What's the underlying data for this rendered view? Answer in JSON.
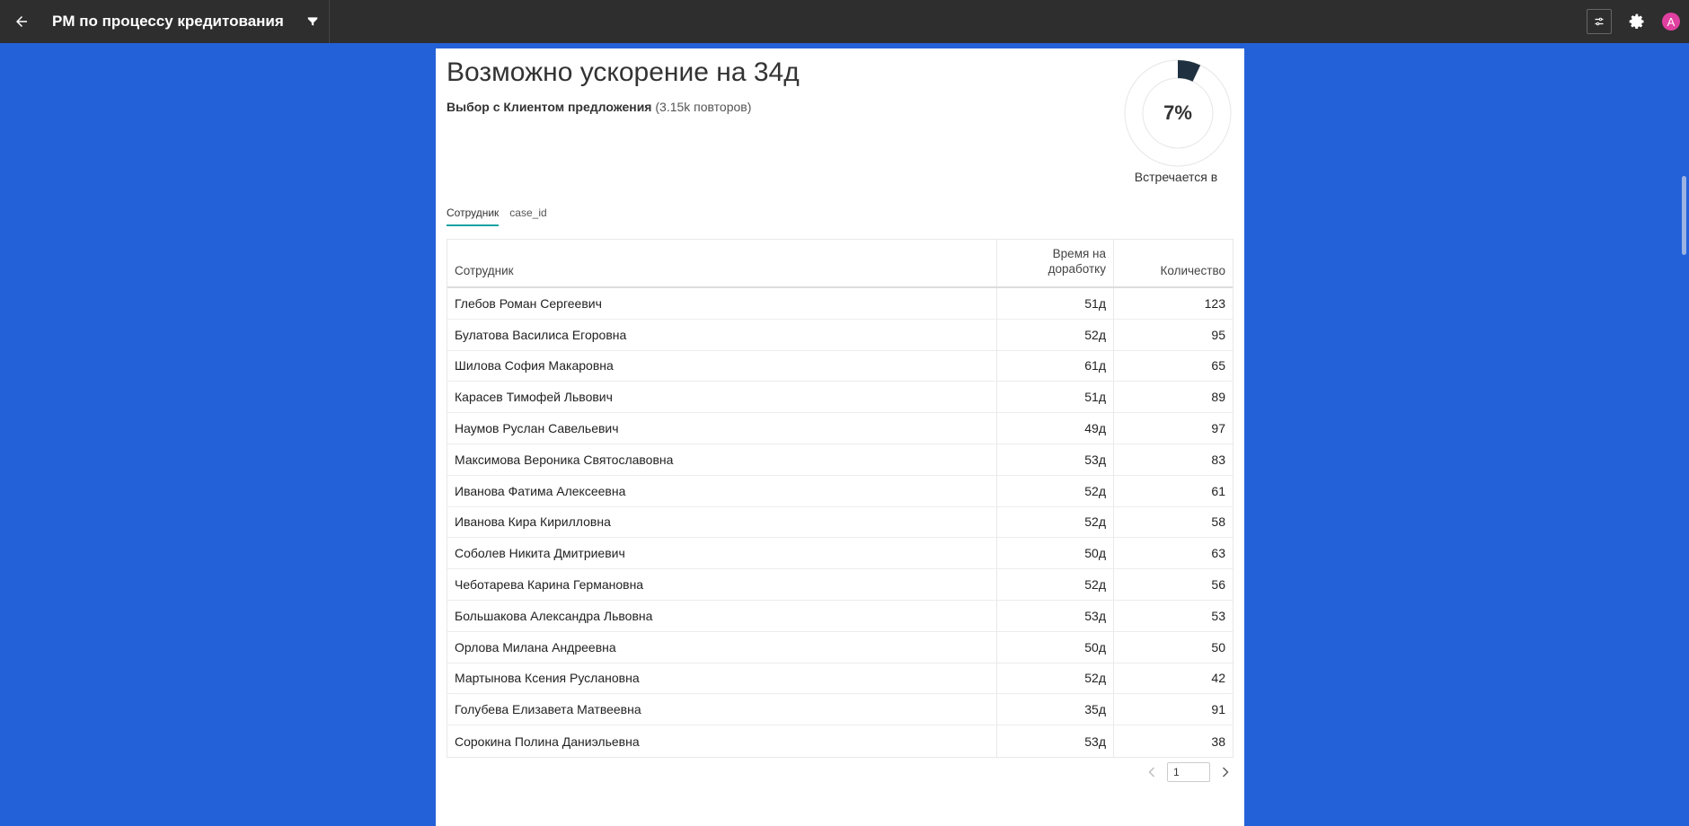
{
  "header": {
    "title": "PM по процессу кредитования",
    "avatar_letter": "A"
  },
  "icons": {
    "back": "arrow-left-icon",
    "filter": "filter-icon",
    "sliders": "sliders-icon",
    "settings": "gear-icon"
  },
  "colors": {
    "background": "#2361d8",
    "topbar": "#2e2e2e",
    "avatar": "#e040a0",
    "tab_accent": "#1aa3a3",
    "donut_fill": "#1f3040"
  },
  "summary": {
    "headline": "Возможно ускорение на 34д",
    "activity": "Выбор с Клиентом предложения",
    "repeats": "(3.15k повторов)",
    "donut_percent_label": "7%",
    "donut_fraction": 0.07,
    "donut_caption": "Встречается в"
  },
  "tabs": [
    {
      "label": "Сотрудник",
      "active": true
    },
    {
      "label": "case_id",
      "active": false
    }
  ],
  "table": {
    "columns": {
      "name": "Сотрудник",
      "time": "Время на доработку",
      "count": "Количество"
    },
    "rows": [
      {
        "name": "Глебов Роман Сергеевич",
        "time": "51д",
        "count": "123"
      },
      {
        "name": "Булатова Василиса Егоровна",
        "time": "52д",
        "count": "95"
      },
      {
        "name": "Шилова София Макаровна",
        "time": "61д",
        "count": "65"
      },
      {
        "name": "Карасев Тимофей Львович",
        "time": "51д",
        "count": "89"
      },
      {
        "name": "Наумов Руслан Савельевич",
        "time": "49д",
        "count": "97"
      },
      {
        "name": "Максимова Вероника Святославовна",
        "time": "53д",
        "count": "83"
      },
      {
        "name": "Иванова Фатима Алексеевна",
        "time": "52д",
        "count": "61"
      },
      {
        "name": "Иванова Кира Кирилловна",
        "time": "52д",
        "count": "58"
      },
      {
        "name": "Соболев Никита Дмитриевич",
        "time": "50д",
        "count": "63"
      },
      {
        "name": "Чеботарева Карина Германовна",
        "time": "52д",
        "count": "56"
      },
      {
        "name": "Большакова Александра Львовна",
        "time": "53д",
        "count": "53"
      },
      {
        "name": "Орлова Милана Андреевна",
        "time": "50д",
        "count": "50"
      },
      {
        "name": "Мартынова Ксения Руслановна",
        "time": "52д",
        "count": "42"
      },
      {
        "name": "Голубева Елизавета Матвеевна",
        "time": "35д",
        "count": "91"
      },
      {
        "name": "Сорокина Полина Даниэльевна",
        "time": "53д",
        "count": "38"
      }
    ]
  },
  "pagination": {
    "page": "1"
  }
}
